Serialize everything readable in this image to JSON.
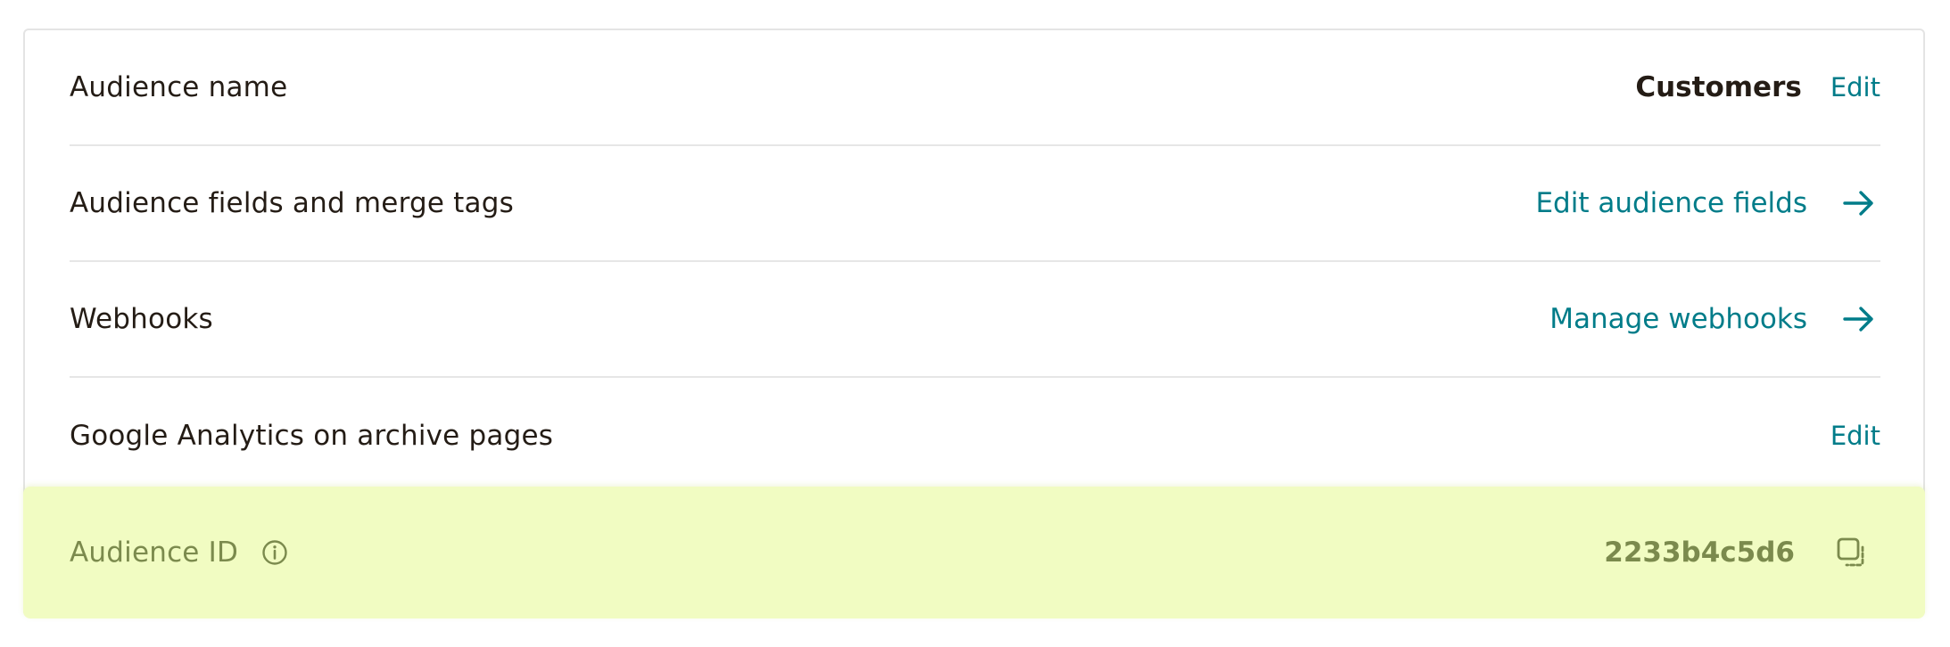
{
  "settings": {
    "rows": [
      {
        "label": "Audience name",
        "value": "Customers",
        "action": "Edit"
      },
      {
        "label": "Audience fields and merge tags",
        "action": "Edit audience fields"
      },
      {
        "label": "Webhooks",
        "action": "Manage webhooks"
      },
      {
        "label": "Google Analytics on archive pages",
        "action": "Edit"
      }
    ],
    "audience_id": {
      "label": "Audience ID",
      "value": "2233b4c5d6"
    }
  },
  "icons": {
    "arrow": "arrow-right-icon",
    "info": "info-icon",
    "copy": "copy-icon"
  },
  "colors": {
    "link": "#007c89",
    "text": "#241c15",
    "highlight_bg": "#f1fcc2",
    "muted_olive": "#7b8a4d",
    "divider": "#e6e6e6"
  }
}
